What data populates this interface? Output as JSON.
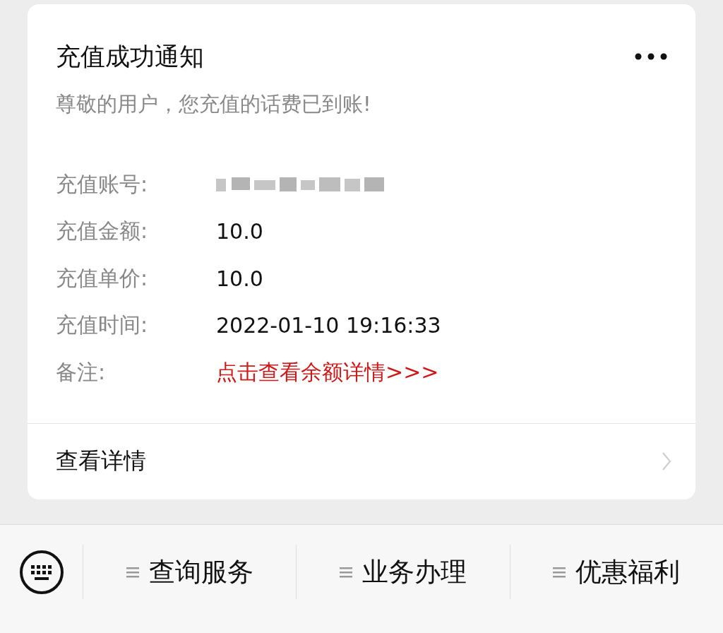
{
  "card": {
    "title": "充值成功通知",
    "subtitle": "尊敬的用户，您充值的话费已到账!",
    "fields": [
      {
        "kind": "redacted",
        "label": "充值账号:"
      },
      {
        "kind": "text",
        "label": "充值金额:",
        "value": "10.0"
      },
      {
        "kind": "text",
        "label": "充值单价:",
        "value": "10.0"
      },
      {
        "kind": "text",
        "label": "充值时间:",
        "value": "2022-01-10 19:16:33"
      },
      {
        "kind": "link",
        "label": "备注:",
        "value": "点击查看余额详情>>>"
      }
    ],
    "footer_link": "查看详情"
  },
  "menu_bar": {
    "items": [
      {
        "label": "查询服务"
      },
      {
        "label": "业务办理"
      },
      {
        "label": "优惠福利"
      }
    ]
  }
}
